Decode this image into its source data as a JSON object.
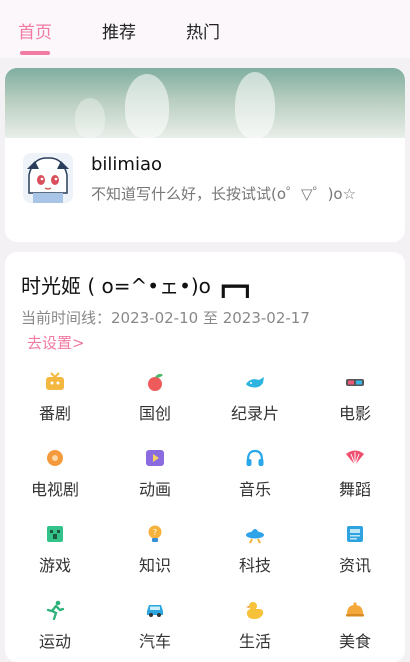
{
  "tabs": [
    {
      "label": "首页",
      "active": true
    },
    {
      "label": "推荐",
      "active": false
    },
    {
      "label": "热门",
      "active": false
    }
  ],
  "profile": {
    "username": "bilimiao",
    "bio": "不知道写什么好，长按试试(o゜▽゜)o☆"
  },
  "timemachine": {
    "title": "时光姬 ( o=^•ェ•)o ┏━┓",
    "timeline": "当前时间线：2023-02-10 至 2023-02-17",
    "set_link": "去设置>"
  },
  "categories": [
    {
      "label": "番剧",
      "icon": "tv-icon",
      "color": "#f4b740"
    },
    {
      "label": "国创",
      "icon": "peach-icon",
      "color": "#ef5a5a"
    },
    {
      "label": "纪录片",
      "icon": "whale-icon",
      "color": "#2eb4e0"
    },
    {
      "label": "电影",
      "icon": "3d-glasses-icon",
      "color": "#e85a7a"
    },
    {
      "label": "电视剧",
      "icon": "tv-series-icon",
      "color": "#f59a3c"
    },
    {
      "label": "动画",
      "icon": "play-icon",
      "color": "#8b6be0"
    },
    {
      "label": "音乐",
      "icon": "headphones-icon",
      "color": "#29a7e8"
    },
    {
      "label": "舞蹈",
      "icon": "fan-icon",
      "color": "#ef4f6f"
    },
    {
      "label": "游戏",
      "icon": "creeper-icon",
      "color": "#33c28a"
    },
    {
      "label": "知识",
      "icon": "lightbulb-icon",
      "color": "#f6b23a"
    },
    {
      "label": "科技",
      "icon": "ufo-icon",
      "color": "#2ea3e8"
    },
    {
      "label": "资讯",
      "icon": "news-icon",
      "color": "#2fa3e0"
    },
    {
      "label": "运动",
      "icon": "running-icon",
      "color": "#2eb07a"
    },
    {
      "label": "汽车",
      "icon": "car-icon",
      "color": "#2ea7e0"
    },
    {
      "label": "生活",
      "icon": "duck-icon",
      "color": "#f6c23a"
    },
    {
      "label": "美食",
      "icon": "food-cover-icon",
      "color": "#f4a83a"
    }
  ]
}
